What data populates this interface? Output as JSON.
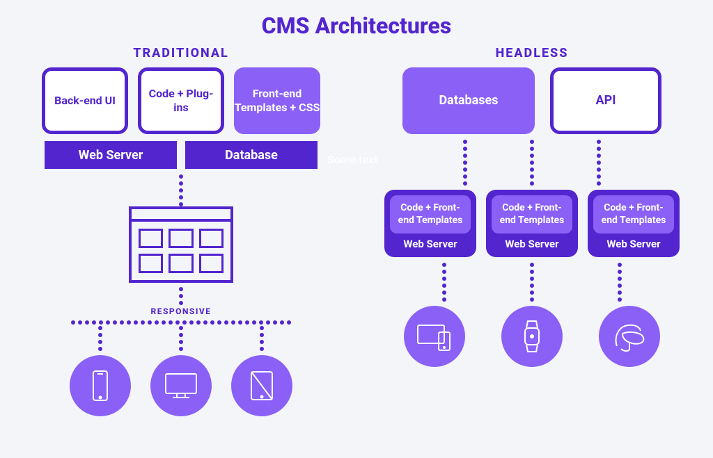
{
  "title": "CMS Architectures",
  "watermark": "Some text",
  "traditional": {
    "header": "TRADITIONAL",
    "boxes": {
      "backend": "Back-end UI",
      "code": "Code + Plug-ins",
      "frontend": "Front-end Templates + CSS"
    },
    "bars": {
      "webserver": "Web Server",
      "database": "Database"
    },
    "responsive_label": "RESPONSIVE",
    "devices": [
      "phone",
      "monitor",
      "tablet"
    ]
  },
  "headless": {
    "header": "HEADLESS",
    "boxes": {
      "databases": "Databases",
      "api": "API"
    },
    "server": {
      "inner": "Code + Front-end Templates",
      "label": "Web Server"
    },
    "devices": [
      "desktop-mobile",
      "watch",
      "vr-headset"
    ]
  }
}
